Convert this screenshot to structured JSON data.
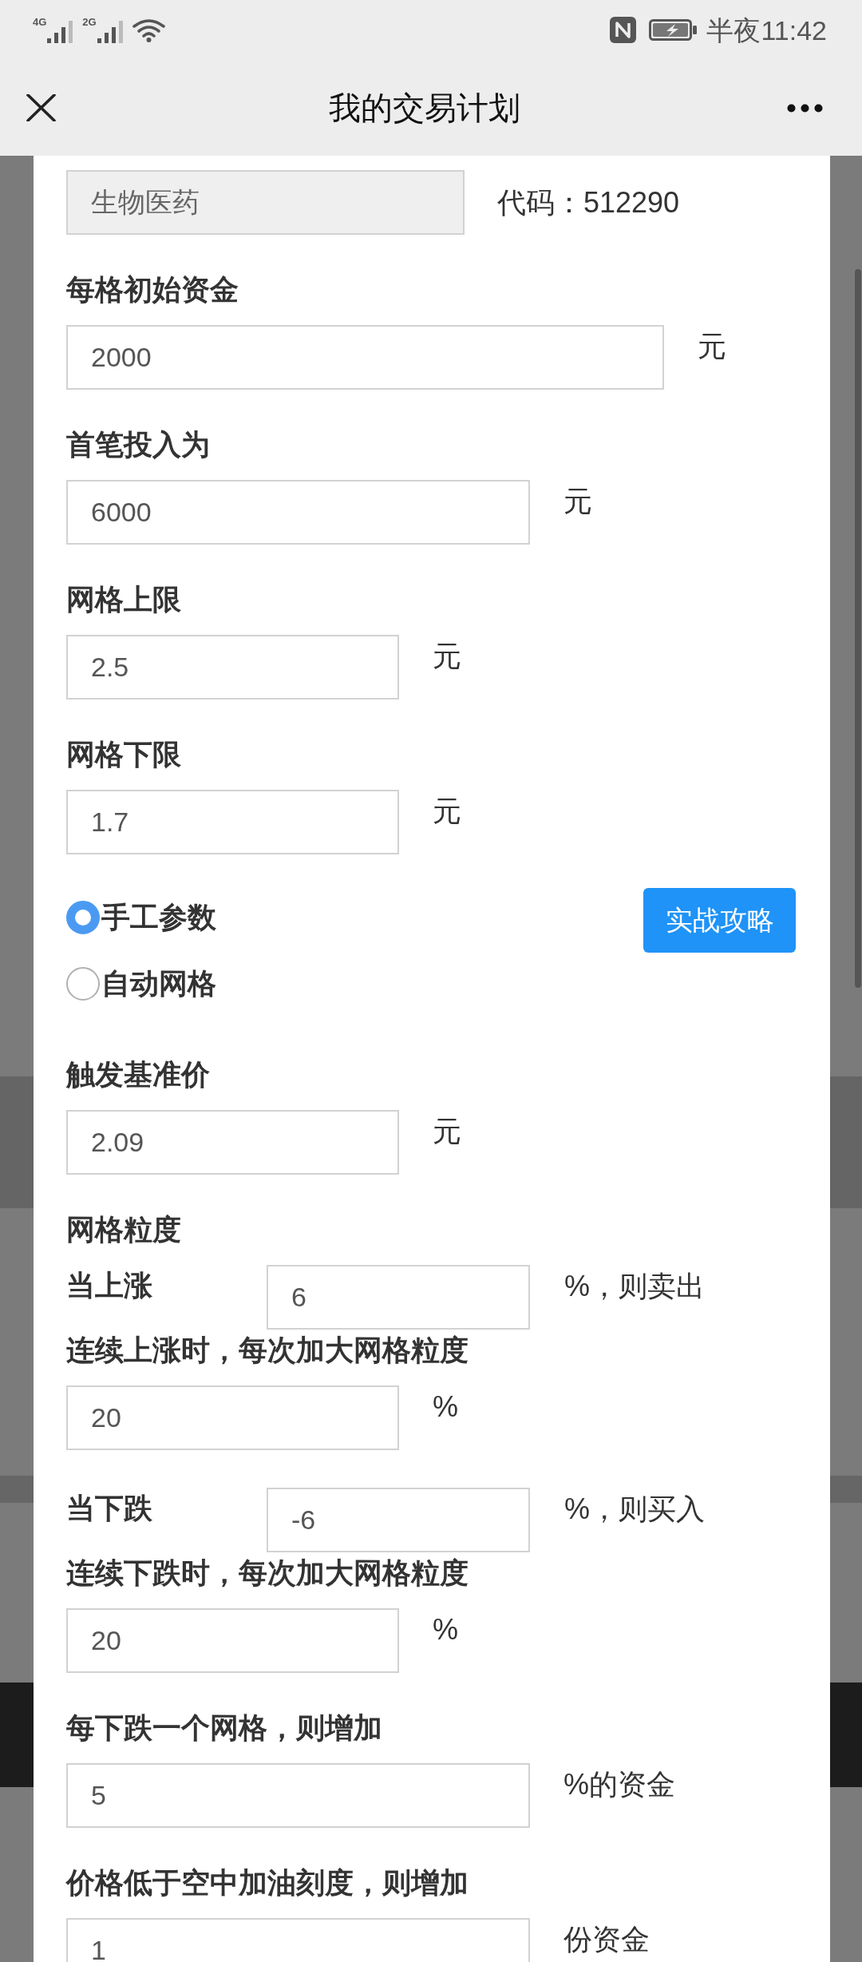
{
  "status_bar": {
    "networks": [
      {
        "type": "4G"
      },
      {
        "type": "2G"
      }
    ],
    "time": "半夜11:42"
  },
  "nav_bar": {
    "title": "我的交易计划"
  },
  "form": {
    "fund": {
      "name": "生物医药",
      "disabled": true,
      "code": "代码：512290"
    },
    "rows": [
      {
        "kind": "field",
        "label": "每格初始资金",
        "value": "2000",
        "unit": "元"
      },
      {
        "kind": "field",
        "label": "首笔投入为",
        "value": "6000",
        "unit": "元"
      },
      {
        "kind": "field",
        "label": "网格上限",
        "value": "2.5",
        "unit": "元"
      },
      {
        "kind": "field",
        "label": "网格下限",
        "value": "1.7",
        "unit": "元"
      },
      {
        "kind": "mode",
        "options": [
          {
            "label": "手工参数",
            "selected": true
          },
          {
            "label": "自动网格",
            "selected": false
          }
        ],
        "button": "实战攻略"
      },
      {
        "kind": "field",
        "label": "触发基准价",
        "value": "2.09",
        "unit": "元"
      },
      {
        "kind": "heading",
        "label": "网格粒度"
      },
      {
        "kind": "inline",
        "label": "当上涨",
        "value": "6",
        "unit": "%，则卖出"
      },
      {
        "kind": "field",
        "label": "连续上涨时，每次加大网格粒度",
        "value": "20",
        "unit": "%"
      },
      {
        "kind": "inline",
        "label": "当下跌",
        "value": "-6",
        "unit": "%，则买入"
      },
      {
        "kind": "field",
        "label": "连续下跌时，每次加大网格粒度",
        "value": "20",
        "unit": "%"
      },
      {
        "kind": "field",
        "label": "每下跌一个网格，则增加",
        "value": "5",
        "unit": "%的资金"
      },
      {
        "kind": "field",
        "label": "价格低于空中加油刻度，则增加",
        "value": "1",
        "unit": "份资金"
      }
    ]
  }
}
